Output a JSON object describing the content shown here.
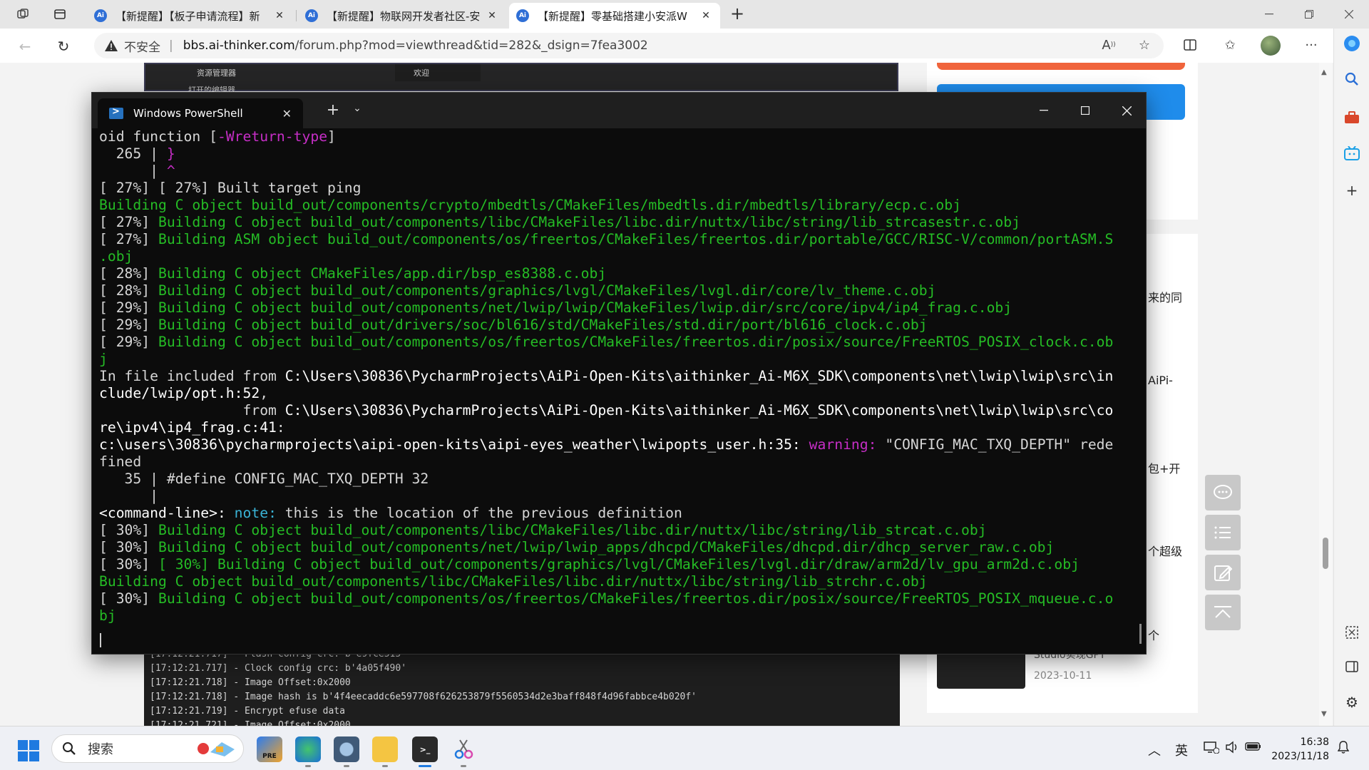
{
  "browser": {
    "tabs": [
      {
        "title": "【新提醒】【板子申请流程】新",
        "favicon": "Ai"
      },
      {
        "title": "【新提醒】物联网开发者社区-安",
        "favicon": "Ai"
      },
      {
        "title": "【新提醒】零基础搭建小安派W",
        "favicon": "Ai"
      }
    ],
    "address": {
      "security_label": "不安全",
      "host": "bbs.ai-thinker.com",
      "path": "/forum.php?mod=viewthread&tid=282&_dsign=7fea3002"
    }
  },
  "page": {
    "vscode_labels": {
      "explorer": "资源管理器",
      "open_editors": "打开的编辑器",
      "welcome_tab": "欢迎"
    },
    "snippets": [
      "来的同",
      "AiPi-",
      "包+开",
      "个超级",
      "个"
    ],
    "article": {
      "title": "Studio实现GPT",
      "date": "2023-10-11"
    },
    "log_lines": [
      "[17:12:21.717] - Flash config crc: b'e9fce515'",
      "[17:12:21.717] - Clock config crc: b'4a05f490'",
      "[17:12:21.718] - Image Offset:0x2000",
      "[17:12:21.718] - Image hash is b'4f4eecaddc6e597708f626253879f5560534d2e3baff848f4d96fabbce4b020f'",
      "[17:12:21.719] - Encrypt efuse data",
      "[17:12:21.721] - Image Offset:0x2000"
    ]
  },
  "terminal": {
    "tab_title": "Windows PowerShell",
    "lines": [
      [
        {
          "t": "oid function [",
          "c": ""
        },
        {
          "t": "-Wreturn-type",
          "c": "m"
        },
        {
          "t": "]",
          "c": ""
        }
      ],
      [
        {
          "t": "  265 | ",
          "c": ""
        },
        {
          "t": "}",
          "c": "m"
        }
      ],
      [
        {
          "t": "      | ",
          "c": ""
        },
        {
          "t": "^",
          "c": "m"
        }
      ],
      [
        {
          "t": "[ 27%] [ 27%] Built target ping",
          "c": ""
        }
      ],
      [
        {
          "t": "Building C object build_out/components/crypto/mbedtls/CMakeFiles/mbedtls.dir/mbedtls/library/ecp.c.obj",
          "c": "g"
        }
      ],
      [
        {
          "t": "[ 27%] ",
          "c": ""
        },
        {
          "t": "Building C object build_out/components/libc/CMakeFiles/libc.dir/nuttx/libc/string/lib_strcasestr.c.obj",
          "c": "g"
        }
      ],
      [
        {
          "t": "[ 27%] ",
          "c": ""
        },
        {
          "t": "Building ASM object build_out/components/os/freertos/CMakeFiles/freertos.dir/portable/GCC/RISC-V/common/portASM.S",
          "c": "g"
        }
      ],
      [
        {
          "t": ".obj",
          "c": "g"
        }
      ],
      [
        {
          "t": "[ 28%] ",
          "c": ""
        },
        {
          "t": "Building C object CMakeFiles/app.dir/bsp_es8388.c.obj",
          "c": "g"
        }
      ],
      [
        {
          "t": "[ 28%] ",
          "c": ""
        },
        {
          "t": "Building C object build_out/components/graphics/lvgl/CMakeFiles/lvgl.dir/core/lv_theme.c.obj",
          "c": "g"
        }
      ],
      [
        {
          "t": "[ 29%] ",
          "c": ""
        },
        {
          "t": "Building C object build_out/components/net/lwip/lwip/CMakeFiles/lwip.dir/src/core/ipv4/ip4_frag.c.obj",
          "c": "g"
        }
      ],
      [
        {
          "t": "[ 29%] ",
          "c": ""
        },
        {
          "t": "Building C object build_out/drivers/soc/bl616/std/CMakeFiles/std.dir/port/bl616_clock.c.obj",
          "c": "g"
        }
      ],
      [
        {
          "t": "[ 29%] ",
          "c": ""
        },
        {
          "t": "Building C object build_out/components/os/freertos/CMakeFiles/freertos.dir/posix/source/FreeRTOS_POSIX_clock.c.ob",
          "c": "g"
        }
      ],
      [
        {
          "t": "j",
          "c": "g"
        }
      ],
      [
        {
          "t": "In file included from ",
          "c": ""
        },
        {
          "t": "C:\\Users\\30836\\PycharmProjects\\AiPi-Open-Kits\\aithinker_Ai-M6X_SDK\\components\\net\\lwip\\lwip\\src\\in",
          "c": "w"
        }
      ],
      [
        {
          "t": "clude/lwip/opt.h:52",
          "c": "w"
        },
        {
          "t": ",",
          "c": ""
        }
      ],
      [
        {
          "t": "                 from ",
          "c": ""
        },
        {
          "t": "C:\\Users\\30836\\PycharmProjects\\AiPi-Open-Kits\\aithinker_Ai-M6X_SDK\\components\\net\\lwip\\lwip\\src\\co",
          "c": "w"
        }
      ],
      [
        {
          "t": "re\\ipv4\\ip4_frag.c:41",
          "c": "w"
        },
        {
          "t": ":",
          "c": ""
        }
      ],
      [
        {
          "t": "c:\\users\\30836\\pycharmprojects\\aipi-open-kits\\aipi-eyes_weather\\lwipopts_user.h:35: ",
          "c": "w"
        },
        {
          "t": "warning: ",
          "c": "m"
        },
        {
          "t": "\"CONFIG_MAC_TXQ_DEPTH\" rede",
          "c": ""
        }
      ],
      [
        {
          "t": "fined",
          "c": ""
        }
      ],
      [
        {
          "t": "   35 | #define CONFIG_MAC_TXQ_DEPTH 32",
          "c": ""
        }
      ],
      [
        {
          "t": "      | ",
          "c": ""
        }
      ],
      [
        {
          "t": "<command-line>: ",
          "c": "w"
        },
        {
          "t": "note: ",
          "c": "c"
        },
        {
          "t": "this is the location of the previous definition",
          "c": ""
        }
      ],
      [
        {
          "t": "[ 30%] ",
          "c": ""
        },
        {
          "t": "Building C object build_out/components/libc/CMakeFiles/libc.dir/nuttx/libc/string/lib_strcat.c.obj",
          "c": "g"
        }
      ],
      [
        {
          "t": "[ 30%] ",
          "c": ""
        },
        {
          "t": "Building C object build_out/components/net/lwip/lwip_apps/dhcpd/CMakeFiles/dhcpd.dir/dhcp_server_raw.c.obj",
          "c": "g"
        }
      ],
      [
        {
          "t": "[ 30%] ",
          "c": ""
        },
        {
          "t": "[ 30%] Building C object build_out/components/graphics/lvgl/CMakeFiles/lvgl.dir/draw/arm2d/lv_gpu_arm2d.c.obj",
          "c": "g"
        }
      ],
      [
        {
          "t": "Building C object build_out/components/libc/CMakeFiles/libc.dir/nuttx/libc/string/lib_strchr.c.obj",
          "c": "g"
        }
      ],
      [
        {
          "t": "[ 30%] ",
          "c": ""
        },
        {
          "t": "Building C object build_out/components/os/freertos/CMakeFiles/freertos.dir/posix/source/FreeRTOS_POSIX_mqueue.c.o",
          "c": "g"
        }
      ],
      [
        {
          "t": "bj",
          "c": "g"
        }
      ]
    ]
  },
  "taskbar": {
    "search_label": "搜索",
    "ime": "英",
    "time": "16:38",
    "date": "2023/11/18"
  }
}
